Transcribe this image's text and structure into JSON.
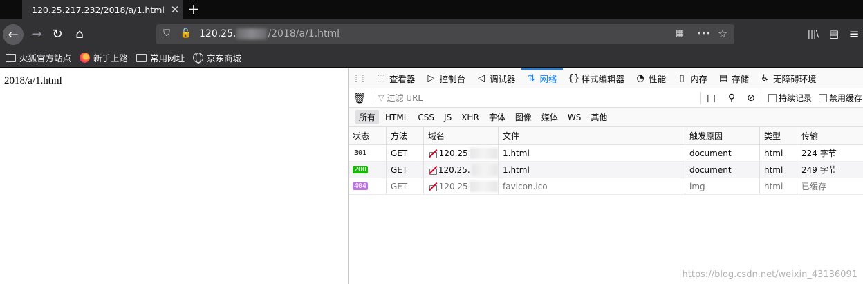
{
  "tab": {
    "title": "120.25.217.232/2018/a/1.html",
    "close": "✕",
    "new_tab": "+"
  },
  "nav": {
    "back": "←",
    "forward": "→",
    "reload": "↻",
    "home": "⌂",
    "url_host": "120.25.",
    "url_path": "/2018/a/1.html",
    "more": "•••",
    "bookmark_star": "☆",
    "library": "|||\\",
    "sidebar": "▤",
    "menu": "≡"
  },
  "bookmarks": [
    {
      "label": "火狐官方站点",
      "icon": "folder-icon"
    },
    {
      "label": "新手上路",
      "icon": "firefox-icon"
    },
    {
      "label": "常用网址",
      "icon": "folder-icon"
    },
    {
      "label": "京东商城",
      "icon": "globe-icon"
    }
  ],
  "page": {
    "text": "2018/a/1.html"
  },
  "devtools": {
    "tabs": [
      {
        "label": "查看器",
        "icon": "⬚",
        "name": "tab-inspector"
      },
      {
        "label": "控制台",
        "icon": "▷",
        "name": "tab-console"
      },
      {
        "label": "调试器",
        "icon": "◁",
        "name": "tab-debugger"
      },
      {
        "label": "网络",
        "icon": "⇅",
        "name": "tab-network",
        "active": true
      },
      {
        "label": "样式编辑器",
        "icon": "{}",
        "name": "tab-style-editor"
      },
      {
        "label": "性能",
        "icon": "◔",
        "name": "tab-performance"
      },
      {
        "label": "内存",
        "icon": "▯",
        "name": "tab-memory"
      },
      {
        "label": "存储",
        "icon": "▤",
        "name": "tab-storage"
      },
      {
        "label": "无障碍环境",
        "icon": "♿",
        "name": "tab-accessibility"
      }
    ],
    "filter_placeholder": "过滤 URL",
    "persist_logs": "持续记录",
    "disable_cache": "禁用缓存",
    "types": [
      "所有",
      "HTML",
      "CSS",
      "JS",
      "XHR",
      "字体",
      "图像",
      "媒体",
      "WS",
      "其他"
    ],
    "columns": [
      "状态",
      "方法",
      "域名",
      "文件",
      "触发原因",
      "类型",
      "传输"
    ],
    "requests": [
      {
        "status": "301",
        "method": "GET",
        "domain": "120.25",
        "file": "1.html",
        "cause": "document",
        "type": "html",
        "transfer": "224 字节"
      },
      {
        "status": "200",
        "method": "GET",
        "domain": "120.25.",
        "file": "1.html",
        "cause": "document",
        "type": "html",
        "transfer": "249 字节"
      },
      {
        "status": "404",
        "method": "GET",
        "domain": "120.25",
        "file": "favicon.ico",
        "cause": "img",
        "type": "html",
        "transfer": "已缓存"
      }
    ]
  },
  "watermark": "https://blog.csdn.net/weixin_43136091"
}
